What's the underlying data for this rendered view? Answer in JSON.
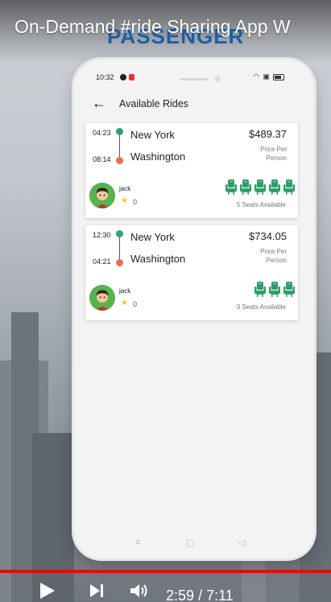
{
  "video": {
    "title": "On-Demand #ride Sharing App W",
    "brand_text": "PASSENGER",
    "current_time": "2:59",
    "separator": "/",
    "duration": "7:11",
    "progress_fraction": 1.0,
    "progress_color": "#ff0000"
  },
  "status_bar": {
    "time": "10:32",
    "icons": [
      "wifi-icon",
      "screen-record-icon",
      "battery-icon"
    ]
  },
  "header": {
    "back_icon": "arrow-left-icon",
    "title": "Available Rides"
  },
  "rides": [
    {
      "departure_time": "04:23",
      "arrival_time": "08:14",
      "from": "New York",
      "to": "Washington",
      "price": "$489.37",
      "price_caption": "Price Per Person",
      "driver_name": "jack",
      "rating": "0",
      "seat_count": 5,
      "seats_label": "5 Seats Available"
    },
    {
      "departure_time": "12:30",
      "arrival_time": "04:21",
      "from": "New York",
      "to": "Washington",
      "price": "$734.05",
      "price_caption": "Price Per Person",
      "driver_name": "jack",
      "rating": "0",
      "seat_count": 3,
      "seats_label": "3 Seats Available"
    }
  ],
  "colors": {
    "route_start": "#2ea36a",
    "route_end": "#ef6b58",
    "seat": "#2e9e6b",
    "star": "#f2c31c"
  }
}
